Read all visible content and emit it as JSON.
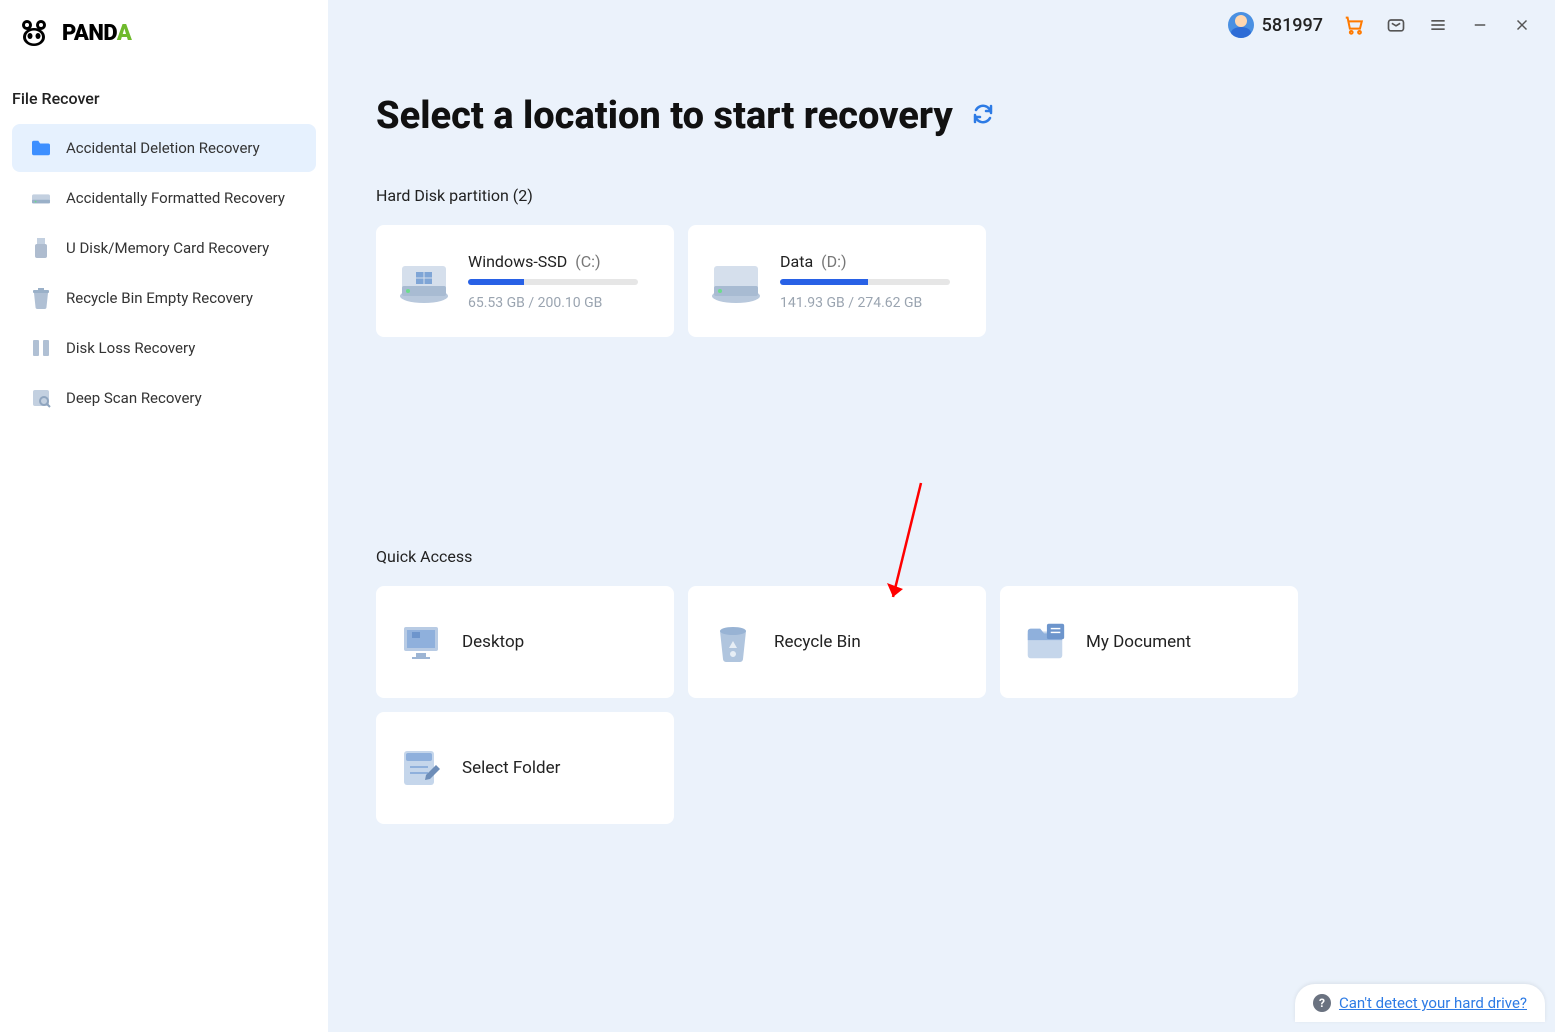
{
  "app": {
    "brand": "PANDA",
    "brandAccentLetter": "A"
  },
  "sidebar": {
    "title": "File Recover",
    "items": [
      {
        "label": "Accidental Deletion Recovery",
        "icon": "folder-icon",
        "active": true
      },
      {
        "label": "Accidentally Formatted Recovery",
        "icon": "drive-icon",
        "active": false
      },
      {
        "label": "U Disk/Memory Card Recovery",
        "icon": "usb-icon",
        "active": false
      },
      {
        "label": "Recycle Bin Empty Recovery",
        "icon": "trash-icon",
        "active": false
      },
      {
        "label": "Disk Loss Recovery",
        "icon": "book-icon",
        "active": false
      },
      {
        "label": "Deep Scan Recovery",
        "icon": "scan-icon",
        "active": false
      }
    ]
  },
  "topbar": {
    "userId": "581997"
  },
  "page": {
    "title": "Select a location to start recovery"
  },
  "partitions": {
    "heading": "Hard Disk partition   (2)",
    "items": [
      {
        "name": "Windows-SSD",
        "letter": "(C:)",
        "used": "65.53 GB",
        "total": "200.10 GB",
        "percent": 33
      },
      {
        "name": "Data",
        "letter": "(D:)",
        "used": "141.93 GB",
        "total": "274.62 GB",
        "percent": 52
      }
    ]
  },
  "quickAccess": {
    "heading": "Quick Access",
    "items": [
      {
        "label": "Desktop",
        "icon": "monitor-icon"
      },
      {
        "label": "Recycle Bin",
        "icon": "bin-icon"
      },
      {
        "label": "My Document",
        "icon": "docfolder-icon"
      },
      {
        "label": "Select Folder",
        "icon": "editfolder-icon"
      }
    ]
  },
  "help": {
    "text": "Can't detect your hard drive?"
  }
}
